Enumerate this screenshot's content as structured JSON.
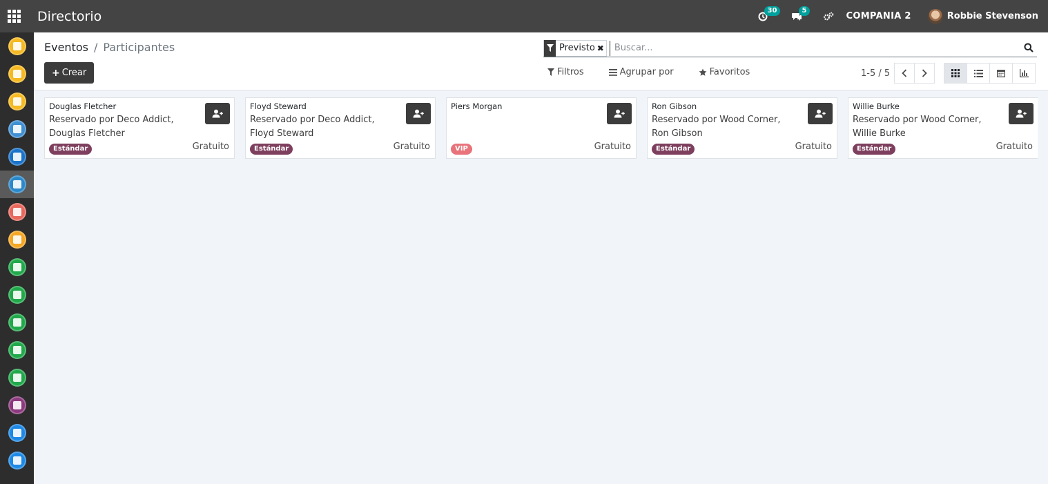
{
  "topbar": {
    "title": "Directorio",
    "activity_count": "30",
    "message_count": "5",
    "company": "COMPANIA 2",
    "user": "Robbie Stevenson"
  },
  "sidebar": {
    "apps": [
      {
        "color": "#f5b921"
      },
      {
        "color": "#f5b921"
      },
      {
        "color": "#f5b921"
      },
      {
        "color": "#3f8fd2"
      },
      {
        "color": "#1a73c9"
      },
      {
        "color": "#2b88c9"
      },
      {
        "color": "#e8685d"
      },
      {
        "color": "#f5a623"
      },
      {
        "color": "#21a84a"
      },
      {
        "color": "#21a84a"
      },
      {
        "color": "#21a84a"
      },
      {
        "color": "#21a84a"
      },
      {
        "color": "#21a84a"
      },
      {
        "color": "#8c3a7e"
      },
      {
        "color": "#1e88e5"
      },
      {
        "color": "#1e88e5"
      }
    ],
    "active_index": 5
  },
  "breadcrumb": {
    "parent": "Eventos",
    "current": "Participantes"
  },
  "create_label": "Crear",
  "search": {
    "facet": "Previsto",
    "placeholder": "Buscar..."
  },
  "filters": {
    "filtros": "Filtros",
    "agrupar": "Agrupar por",
    "favoritos": "Favoritos"
  },
  "pager": {
    "value": "1-5 / 5"
  },
  "colors": {
    "estandar": "#7e3f5e",
    "vip": "#e8737a",
    "topbar": "#444444",
    "sidebar": "#2d2d2d"
  },
  "cards": [
    {
      "name": "Douglas Fletcher",
      "reservation": "Reservado por Deco Addict, Douglas Fletcher",
      "tag": "Estándar",
      "price": "Gratuito"
    },
    {
      "name": "Floyd Steward",
      "reservation": "Reservado por Deco Addict, Floyd Steward",
      "tag": "Estándar",
      "price": "Gratuito"
    },
    {
      "name": "Piers Morgan",
      "reservation": "",
      "tag": "VIP",
      "price": "Gratuito"
    },
    {
      "name": "Ron Gibson",
      "reservation": "Reservado por Wood Corner, Ron Gibson",
      "tag": "Estándar",
      "price": "Gratuito"
    },
    {
      "name": "Willie Burke",
      "reservation": "Reservado por Wood Corner, Willie Burke",
      "tag": "Estándar",
      "price": "Gratuito"
    }
  ]
}
